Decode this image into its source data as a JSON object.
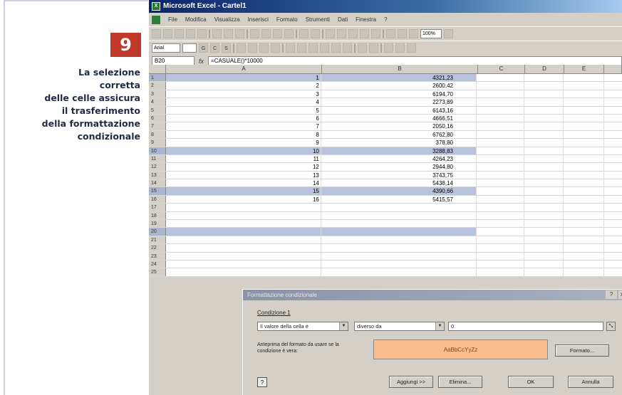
{
  "caption": {
    "step_number": "9",
    "lines": [
      "La selezione",
      "corretta",
      "delle celle assicura",
      "il trasferimento",
      "della formattazione",
      "condizionale"
    ]
  },
  "excel": {
    "window_title": "Microsoft Excel - Cartel1",
    "menu": [
      "File",
      "Modifica",
      "Visualizza",
      "Inserisci",
      "Formato",
      "Strumenti",
      "Dati",
      "Finestra",
      "?"
    ],
    "zoom": "100%",
    "font_box": "Arial",
    "name_box": "B20",
    "formula": "=CASUALE()*10000",
    "columns": [
      "A",
      "B",
      "C",
      "D",
      "E"
    ],
    "rows": [
      {
        "n": "1",
        "a": "1",
        "b": "4321,23",
        "hl": true
      },
      {
        "n": "2",
        "a": "2",
        "b": "2600,42",
        "hl": false
      },
      {
        "n": "3",
        "a": "3",
        "b": "6194,70",
        "hl": false
      },
      {
        "n": "4",
        "a": "4",
        "b": "2273,89",
        "hl": false
      },
      {
        "n": "5",
        "a": "5",
        "b": "6143,16",
        "hl": false
      },
      {
        "n": "6",
        "a": "6",
        "b": "4666,51",
        "hl": false
      },
      {
        "n": "7",
        "a": "7",
        "b": "2050,16",
        "hl": false
      },
      {
        "n": "8",
        "a": "8",
        "b": "6762,80",
        "hl": false
      },
      {
        "n": "9",
        "a": "9",
        "b": "378,80",
        "hl": false
      },
      {
        "n": "10",
        "a": "10",
        "b": "3288,83",
        "hl": true
      },
      {
        "n": "11",
        "a": "11",
        "b": "4264,23",
        "hl": false
      },
      {
        "n": "12",
        "a": "12",
        "b": "2944,80",
        "hl": false
      },
      {
        "n": "13",
        "a": "13",
        "b": "3743,75",
        "hl": false
      },
      {
        "n": "14",
        "a": "14",
        "b": "5438,14",
        "hl": false
      },
      {
        "n": "15",
        "a": "15",
        "b": "4390,66",
        "hl": true
      },
      {
        "n": "16",
        "a": "16",
        "b": "5415,57",
        "hl": false
      },
      {
        "n": "17",
        "a": "",
        "b": "",
        "hl": false
      },
      {
        "n": "18",
        "a": "",
        "b": "",
        "hl": false
      },
      {
        "n": "19",
        "a": "",
        "b": "",
        "hl": false
      },
      {
        "n": "20",
        "a": "",
        "b": "",
        "hl": true
      },
      {
        "n": "21",
        "a": "",
        "b": "",
        "hl": false
      },
      {
        "n": "22",
        "a": "",
        "b": "",
        "hl": false
      },
      {
        "n": "23",
        "a": "",
        "b": "",
        "hl": false
      },
      {
        "n": "24",
        "a": "",
        "b": "",
        "hl": false
      },
      {
        "n": "25",
        "a": "",
        "b": "",
        "hl": false
      }
    ]
  },
  "dialog": {
    "title": "Formattazione condizionale",
    "help": "?",
    "close": "x",
    "condition_label": "Condizione 1",
    "select_1": "Il valore della cella è",
    "select_2": "diverso da",
    "value": "0",
    "preview_label": "Anteprima del formato da usare se la condizione è vera:",
    "preview_sample": "AaBbCcYyZz",
    "format_button": "Formato...",
    "add_button": "Aggiungi >>",
    "delete_button": "Elimina...",
    "ok_button": "OK",
    "cancel_button": "Annulla"
  }
}
